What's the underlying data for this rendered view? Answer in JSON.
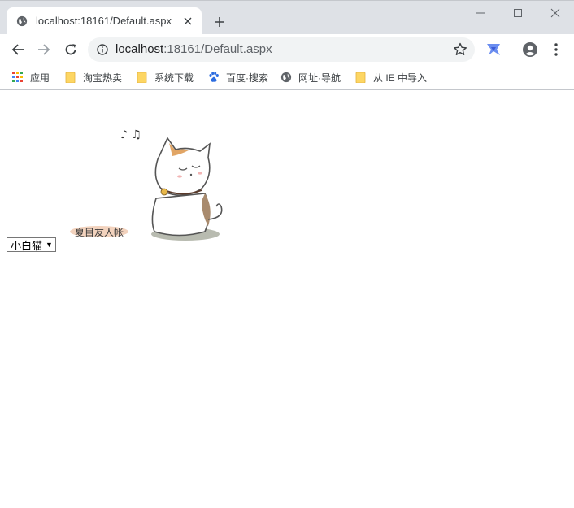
{
  "browser": {
    "tab": {
      "title": "localhost:18161/Default.aspx",
      "favicon": "globe-icon"
    },
    "new_tab_label": "+",
    "address": {
      "host": "localhost",
      "rest": ":18161/Default.aspx"
    },
    "bookmarks": [
      {
        "label": "应用",
        "icon": "apps-grid-icon"
      },
      {
        "label": "淘宝热卖",
        "icon": "folder-icon"
      },
      {
        "label": "系统下载",
        "icon": "folder-icon"
      },
      {
        "label": "百度·搜索",
        "icon": "baidu-paw-icon"
      },
      {
        "label": "网址·导航",
        "icon": "globe-icon"
      },
      {
        "label": "从 IE 中导入",
        "icon": "folder-icon"
      }
    ]
  },
  "page": {
    "select": {
      "value": "小白猫",
      "arrow": "▼"
    },
    "image": {
      "subject": "white cat",
      "caption_text": "夏目友人帐",
      "notes": "♪ ♫"
    }
  },
  "colors": {
    "tabstrip": "#dee1e6",
    "omnibox": "#f1f3f4",
    "folder": "#fdd663",
    "baidu": "#2d6de0"
  }
}
